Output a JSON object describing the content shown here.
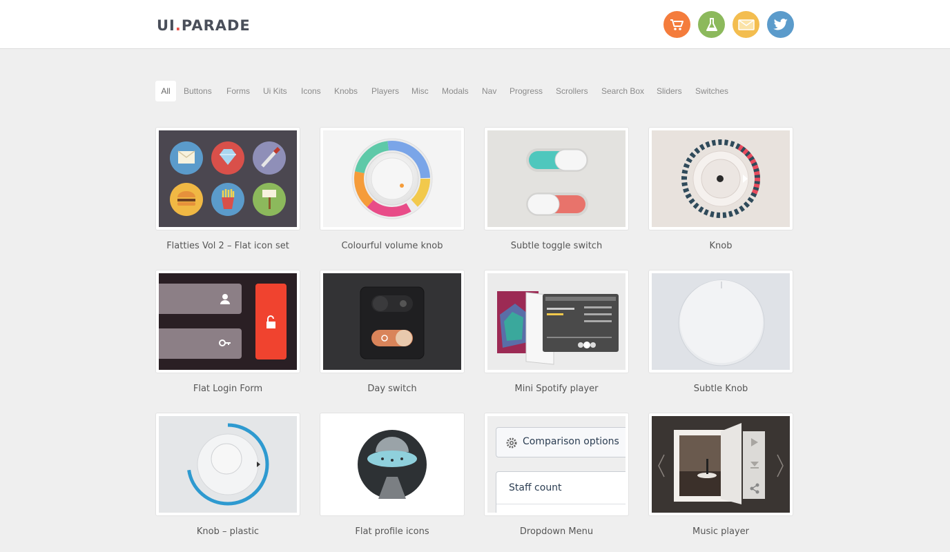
{
  "header": {
    "logo_part1": "UI",
    "logo_dot": ".",
    "logo_part2": "PARADE",
    "icons": [
      {
        "name": "cart-icon",
        "color": "#f47c3c"
      },
      {
        "name": "flask-icon",
        "color": "#8cb95c"
      },
      {
        "name": "mail-icon",
        "color": "#f3bd4f"
      },
      {
        "name": "twitter-icon",
        "color": "#5b9bcb"
      }
    ]
  },
  "filters": {
    "active": "All",
    "items": [
      "All",
      "Buttons",
      "Forms",
      "Ui Kits",
      "Icons",
      "Knobs",
      "Players",
      "Misc",
      "Modals",
      "Nav",
      "Progress",
      "Scrollers",
      "Search Box",
      "Sliders",
      "Switches"
    ]
  },
  "items": [
    {
      "title": "Flatties Vol 2 – Flat icon set"
    },
    {
      "title": "Colourful volume knob"
    },
    {
      "title": "Subtle toggle switch"
    },
    {
      "title": "Knob"
    },
    {
      "title": "Flat Login Form"
    },
    {
      "title": "Day switch"
    },
    {
      "title": "Mini Spotify player"
    },
    {
      "title": "Subtle Knob"
    },
    {
      "title": "Knob – plastic"
    },
    {
      "title": "Flat profile icons"
    },
    {
      "title": "Dropdown Menu",
      "thumb_text": [
        "Comparison options",
        "Staff count"
      ]
    },
    {
      "title": "Music player"
    }
  ]
}
